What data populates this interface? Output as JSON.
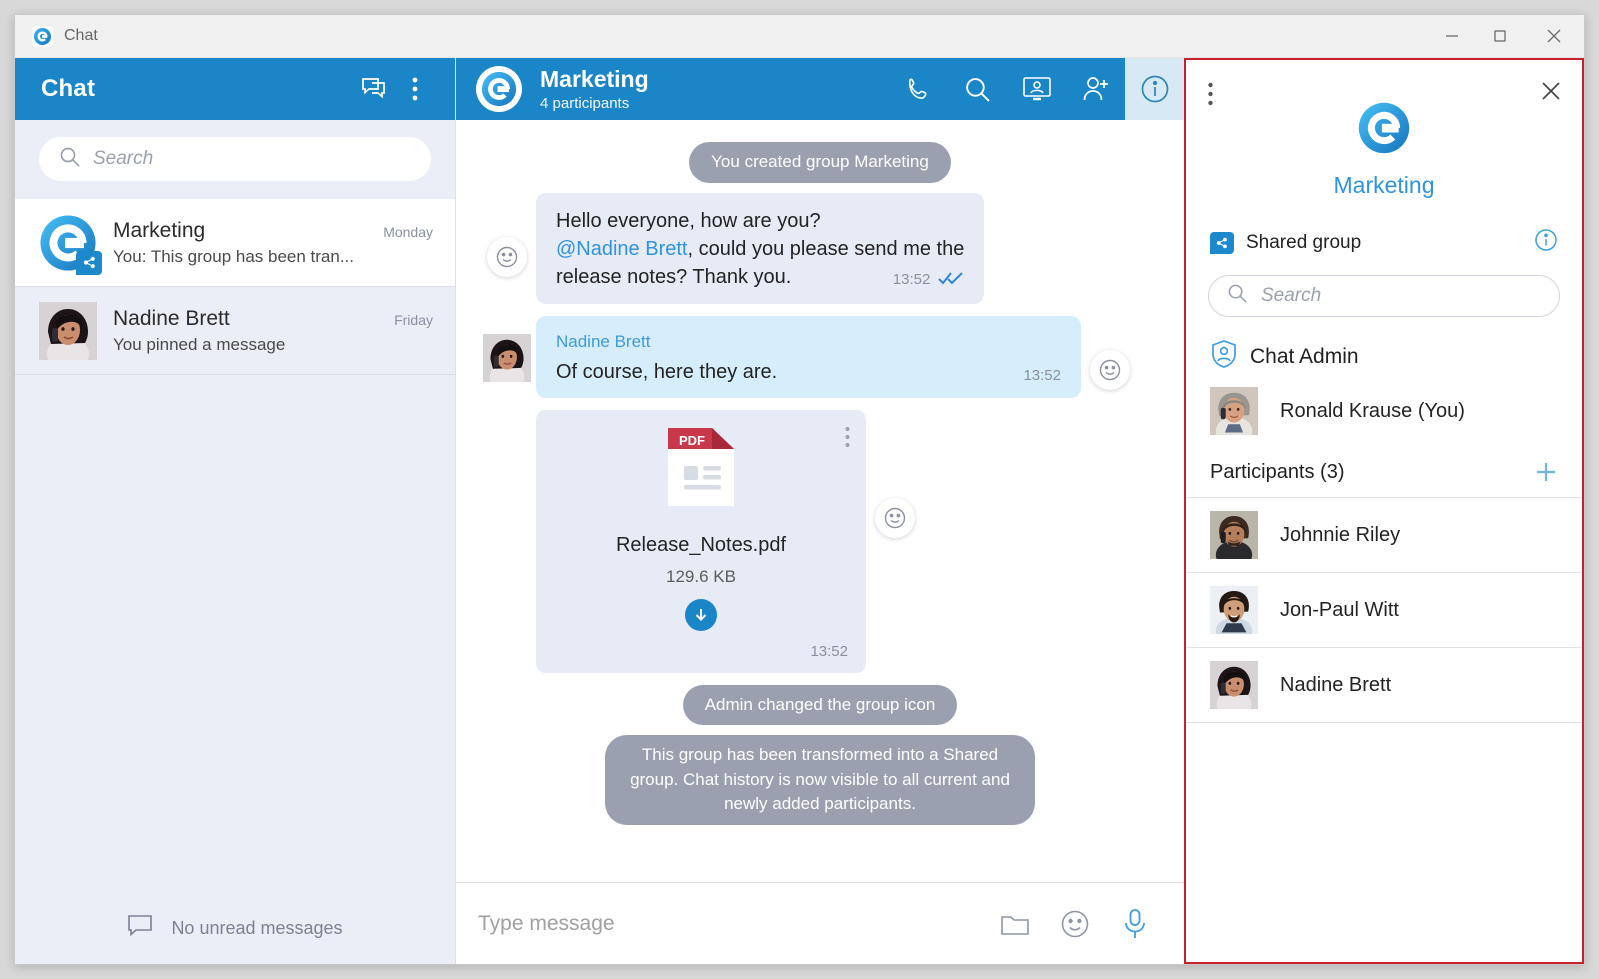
{
  "window": {
    "title": "Chat",
    "app_icon": "app-logo-icon",
    "controls": {
      "minimize": "—",
      "maximize": "☐",
      "close": "✕"
    }
  },
  "sidebar": {
    "header": {
      "title": "Chat",
      "new_chat_icon": "new-chat-icon",
      "menu_icon": "kebab-menu-icon"
    },
    "search": {
      "placeholder": "Search",
      "icon": "search-icon"
    },
    "chats": [
      {
        "name": "Marketing",
        "time": "Monday",
        "preview": "You: This group has been tran...",
        "avatar": "group-logo-avatar",
        "badge": "shared-group-badge",
        "active": true
      },
      {
        "name": "Nadine Brett",
        "time": "Friday",
        "preview": "You pinned a message",
        "avatar": "woman-phone-avatar",
        "badge": "",
        "active": false
      }
    ],
    "footer": {
      "icon": "chat-bubble-icon",
      "label": "No unread messages"
    }
  },
  "chat": {
    "header": {
      "avatar": "group-logo-avatar",
      "title": "Marketing",
      "subtitle": "4 participants",
      "actions": [
        {
          "name": "call-icon",
          "selected": false
        },
        {
          "name": "search-icon",
          "selected": false
        },
        {
          "name": "screen-share-icon",
          "selected": false
        },
        {
          "name": "add-participant-icon",
          "selected": false
        },
        {
          "name": "info-icon",
          "selected": true
        }
      ]
    },
    "messages": [
      {
        "kind": "system",
        "text": "You created group Marketing"
      },
      {
        "kind": "outgoing",
        "line1": "Hello everyone, how are you?",
        "mention": "@Nadine Brett",
        "line2": ", could you please send me the",
        "line3": "release notes? Thank you.",
        "time": "13:52",
        "ticks": "✓✓",
        "react_icon": "emoji-reaction-icon"
      },
      {
        "kind": "incoming",
        "sender": "Nadine Brett",
        "text": "Of course, here they are.",
        "time": "13:52",
        "avatar": "woman-phone-avatar",
        "react_icon": "emoji-reaction-icon"
      },
      {
        "kind": "file",
        "file_type": "PDF",
        "file_name": "Release_Notes.pdf",
        "file_size": "129.6 KB",
        "time": "13:52",
        "download_icon": "download-icon",
        "kebab_icon": "kebab-menu-icon",
        "react_icon": "emoji-reaction-icon"
      },
      {
        "kind": "system",
        "text": "Admin changed the group icon"
      },
      {
        "kind": "system",
        "text": "This group has been transformed into a Shared group. Chat history is now visible to all current and newly added participants."
      }
    ],
    "composer": {
      "placeholder": "Type message",
      "icons": [
        {
          "name": "attach-folder-icon"
        },
        {
          "name": "emoji-icon"
        },
        {
          "name": "microphone-icon"
        }
      ]
    }
  },
  "info_panel": {
    "menu_icon": "kebab-menu-icon",
    "close_icon": "close-icon",
    "logo": "group-logo-icon",
    "group_name": "Marketing",
    "shared_label": "Shared group",
    "shared_icon": "shared-group-badge",
    "shared_info_icon": "info-circle-icon",
    "search": {
      "placeholder": "Search",
      "icon": "search-icon"
    },
    "admin_section": {
      "icon": "shield-person-icon",
      "label": "Chat Admin",
      "person": {
        "name": "Ronald Krause (You)",
        "avatar": "man-phone-avatar"
      }
    },
    "participants_header": {
      "label": "Participants (3)",
      "add_icon": "plus-icon"
    },
    "participants": [
      {
        "name": "Johnnie Riley",
        "avatar": "man-phone-dark-avatar"
      },
      {
        "name": "Jon-Paul Witt",
        "avatar": "man-beard-avatar"
      },
      {
        "name": "Nadine Brett",
        "avatar": "woman-phone-avatar"
      }
    ]
  },
  "colors": {
    "brand_blue": "#1a86c8",
    "sidebar_bg": "#ebeef7",
    "outgoing_bubble": "#e7ebf6",
    "incoming_bubble": "#d6eefc",
    "system_bubble": "#9aa0b0",
    "highlight_border": "#cc1f2e",
    "link_blue": "#2f93e0"
  }
}
